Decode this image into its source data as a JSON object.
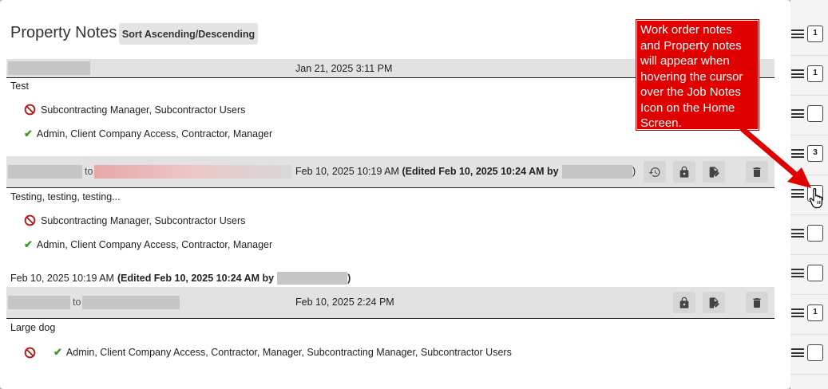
{
  "panel": {
    "title": "Property Notes",
    "sort_button": "Sort Ascending/Descending"
  },
  "notes": [
    {
      "timestamp": "Jan 21, 2025 3:11 PM",
      "text": "Test",
      "denied": "Subcontracting Manager, Subcontractor Users",
      "allowed": "Admin, Client Company Access, Contractor, Manager"
    },
    {
      "to_label": "to",
      "timestamp": "Feb 10, 2025 10:19 AM",
      "edited_prefix": "(Edited Feb 10, 2025 10:24 AM by",
      "edited_suffix": ")",
      "text": "Testing, testing, testing...",
      "denied": "Subcontracting Manager, Subcontractor Users",
      "allowed": "Admin, Client Company Access, Contractor, Manager",
      "footer_timestamp": "Feb 10, 2025 10:19 AM",
      "footer_edited_prefix": "(Edited Feb 10, 2025 10:24 AM by",
      "footer_edited_suffix": ")"
    },
    {
      "to_label": "to",
      "timestamp": "Feb 10, 2025 2:24 PM",
      "text": "Large dog",
      "allowed": "Admin, Client Company Access, Contractor, Manager, Subcontracting Manager, Subcontractor Users"
    }
  ],
  "callout": {
    "text": "Work order notes and Property notes will appear when hovering the cursor over the Job Notes Icon on the Home Screen."
  },
  "sidebar": {
    "note_counts": [
      "1",
      "1",
      "",
      "3",
      "",
      "",
      "",
      "1",
      ""
    ]
  },
  "icons": {
    "history": "history-icon",
    "lock": "lock-icon",
    "edit": "edit-note-icon",
    "delete": "trash-icon",
    "deny": "prohibited-icon",
    "allow": "checkmark-icon"
  },
  "colors": {
    "callout_bg": "#e00000",
    "deny_red": "#b51a1a",
    "check_green": "#3a9a1c"
  }
}
